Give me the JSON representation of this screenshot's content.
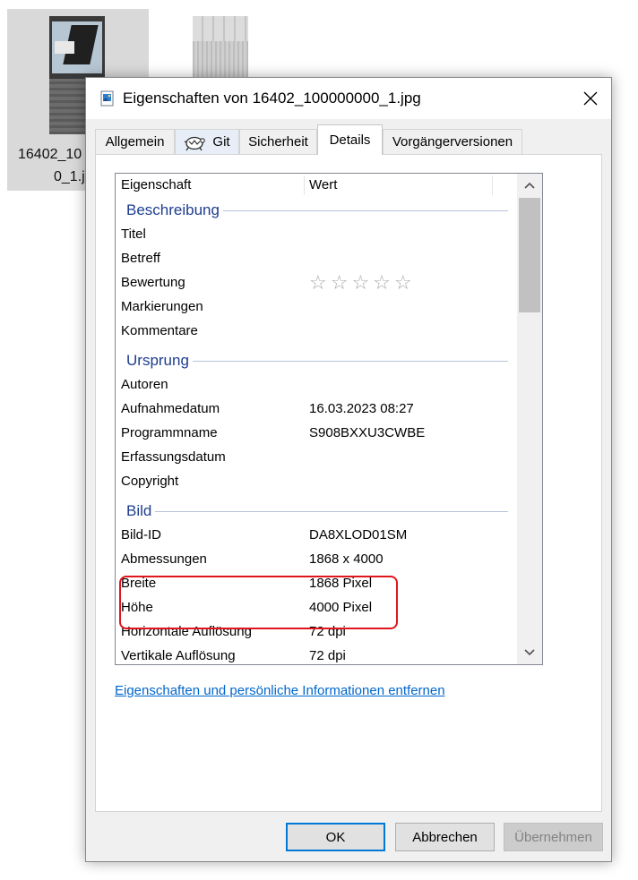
{
  "desktop": {
    "file1_name_line1": "16402_10",
    "file1_name_line2": "0_1.j"
  },
  "window": {
    "title": "Eigenschaften von 16402_100000000_1.jpg"
  },
  "tabs": [
    {
      "label": "Allgemein"
    },
    {
      "label": "Git"
    },
    {
      "label": "Sicherheit"
    },
    {
      "label": "Details"
    },
    {
      "label": "Vorgängerversionen"
    }
  ],
  "list": {
    "header_property": "Eigenschaft",
    "header_value": "Wert",
    "groups": {
      "description": "Beschreibung",
      "origin": "Ursprung",
      "image": "Bild"
    },
    "rows": {
      "title": {
        "prop": "Titel",
        "val": ""
      },
      "subject": {
        "prop": "Betreff",
        "val": ""
      },
      "rating": {
        "prop": "Bewertung",
        "val": "☆☆☆☆☆"
      },
      "tags": {
        "prop": "Markierungen",
        "val": ""
      },
      "comments": {
        "prop": "Kommentare",
        "val": ""
      },
      "authors": {
        "prop": "Autoren",
        "val": ""
      },
      "date_taken": {
        "prop": "Aufnahmedatum",
        "val": "16.03.2023 08:27"
      },
      "program": {
        "prop": "Programmname",
        "val": "S908BXXU3CWBE"
      },
      "date_acquired": {
        "prop": "Erfassungsdatum",
        "val": ""
      },
      "copyright": {
        "prop": "Copyright",
        "val": ""
      },
      "image_id": {
        "prop": "Bild-ID",
        "val": "DA8XLOD01SM"
      },
      "dimensions": {
        "prop": "Abmessungen",
        "val": "1868 x 4000"
      },
      "width": {
        "prop": "Breite",
        "val": "1868 Pixel"
      },
      "height": {
        "prop": "Höhe",
        "val": "4000 Pixel"
      },
      "hres": {
        "prop": "Horizontale Auflösung",
        "val": "72 dpi"
      },
      "vres": {
        "prop": "Vertikale Auflösung",
        "val": "72 dpi"
      }
    }
  },
  "remove_link": "Eigenschaften und persönliche Informationen entfernen",
  "buttons": {
    "ok": "OK",
    "cancel": "Abbrechen",
    "apply": "Übernehmen"
  },
  "colors": {
    "highlight": "#e0161e",
    "link": "#0066cc",
    "group_label": "#1e3d8f",
    "ok_border": "#0078d7"
  }
}
